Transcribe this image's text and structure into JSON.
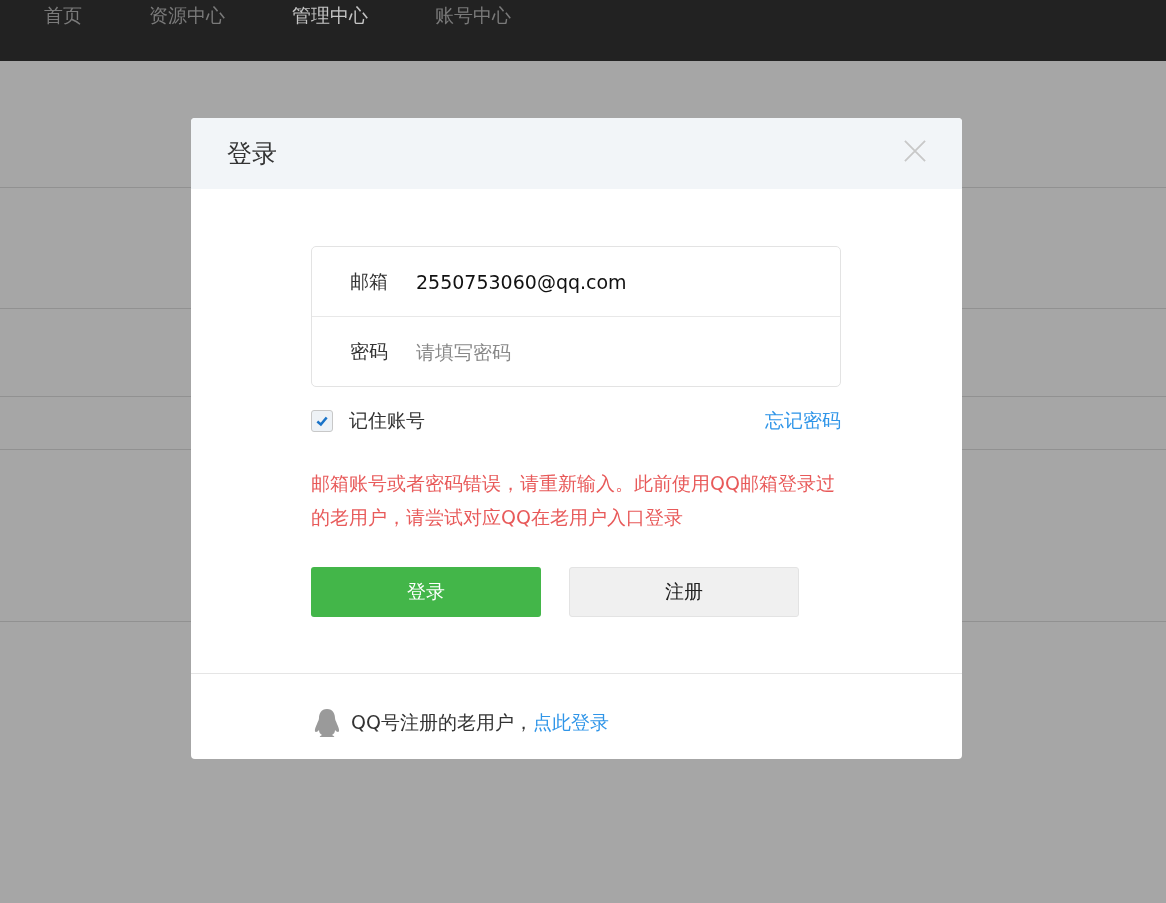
{
  "nav": {
    "items": [
      {
        "label": "首页",
        "selected": false
      },
      {
        "label": "资源中心",
        "selected": false
      },
      {
        "label": "管理中心",
        "selected": true
      },
      {
        "label": "账号中心",
        "selected": false
      }
    ]
  },
  "dialog": {
    "title": "登录",
    "fields": [
      {
        "label": "邮箱",
        "value": "2550753060@qq.com"
      },
      {
        "label": "密码",
        "placeholder": "请填写密码"
      }
    ],
    "remember": {
      "label": "记住账号",
      "checked": true
    },
    "forgot_link": "忘记密码",
    "error": "邮箱账号或者密码错误，请重新输入。此前使用QQ邮箱登录过的老用户，请尝试对应QQ在老用户入口登录",
    "buttons": [
      {
        "label": "登录",
        "kind": "primary"
      },
      {
        "label": "注册",
        "kind": "secondary"
      }
    ],
    "footer": {
      "text": "QQ号注册的老用户，",
      "link": "点此登录"
    }
  }
}
